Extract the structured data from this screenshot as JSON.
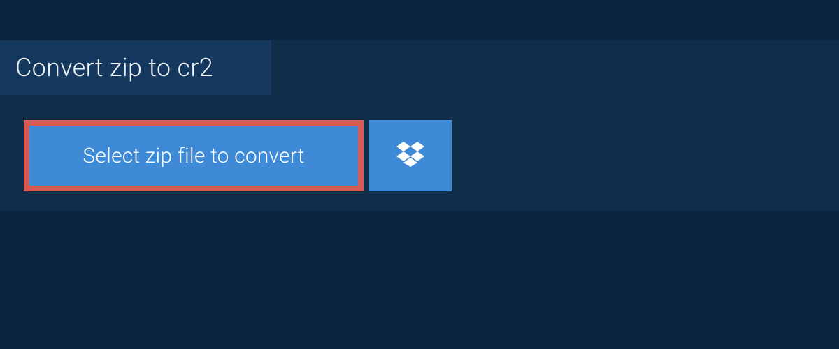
{
  "header": {
    "title": "Convert zip to cr2"
  },
  "actions": {
    "select_file_label": "Select zip file to convert",
    "dropbox_icon_name": "dropbox-icon"
  },
  "colors": {
    "page_bg": "#0a2540",
    "panel_bg": "#102e4a",
    "tab_bg": "#15395e",
    "button_bg": "#3f8ad6",
    "highlight_border": "#d85a55",
    "text_light": "#eef3f8",
    "text_white": "#ffffff"
  }
}
